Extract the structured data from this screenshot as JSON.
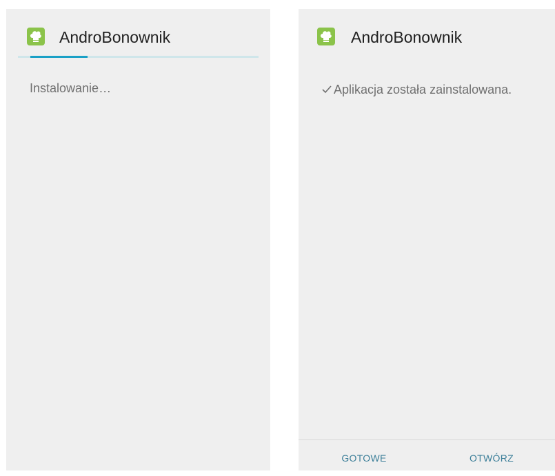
{
  "left_screen": {
    "app_name": "AndroBonownik",
    "app_icon": "chef-hat-icon",
    "status": "Instalowanie…",
    "progress": 0.25,
    "colors": {
      "progress_fill": "#1aa0c6",
      "progress_track": "#cfe6ea",
      "icon_bg": "#8bc34a"
    }
  },
  "right_screen": {
    "app_name": "AndroBonownik",
    "app_icon": "chef-hat-icon",
    "check_icon": "check-icon",
    "status": "Aplikacja została zainstalowana.",
    "buttons": {
      "done": "GOTOWE",
      "open": "OTWÓRZ"
    },
    "colors": {
      "button_text": "#3c7f99",
      "icon_bg": "#8bc34a"
    }
  }
}
